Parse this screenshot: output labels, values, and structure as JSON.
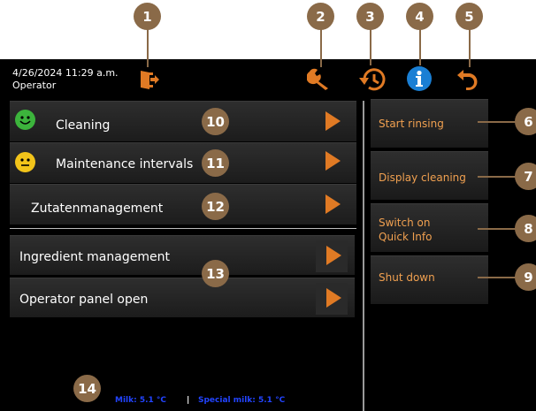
{
  "header": {
    "datetime": "4/26/2024 11:29 a.m.",
    "user": "Operator",
    "icons": [
      "logout-icon",
      "wrench-icon",
      "history-icon",
      "info-icon",
      "back-icon"
    ]
  },
  "callouts": [
    "1",
    "2",
    "3",
    "4",
    "5",
    "6",
    "7",
    "8",
    "9",
    "10",
    "11",
    "12",
    "13",
    "14"
  ],
  "left_buttons": [
    {
      "label": "Cleaning",
      "status": "green"
    },
    {
      "label": "Maintenance intervals",
      "status": "yellow"
    },
    {
      "label": "Zutatenmanagement"
    }
  ],
  "lower_buttons": [
    {
      "label": "Ingredient management"
    },
    {
      "label": "Operator panel open"
    }
  ],
  "right_buttons": [
    {
      "label": "Start rinsing"
    },
    {
      "label": "Display cleaning"
    },
    {
      "label_line1": "Switch on",
      "label_line2": "Quick Info"
    },
    {
      "label": "Shut down"
    }
  ],
  "footer": {
    "milk": "Milk: 5.1 °C",
    "separator": "|",
    "special_milk": "Special milk: 5.1 °C"
  },
  "colors": {
    "accent_orange": "#e07a24",
    "callout_brown": "#8a6a48",
    "info_blue": "#1a7fd4",
    "status_green": "#3cb43c",
    "status_yellow": "#f2c41a",
    "footer_blue": "#2244ff"
  }
}
